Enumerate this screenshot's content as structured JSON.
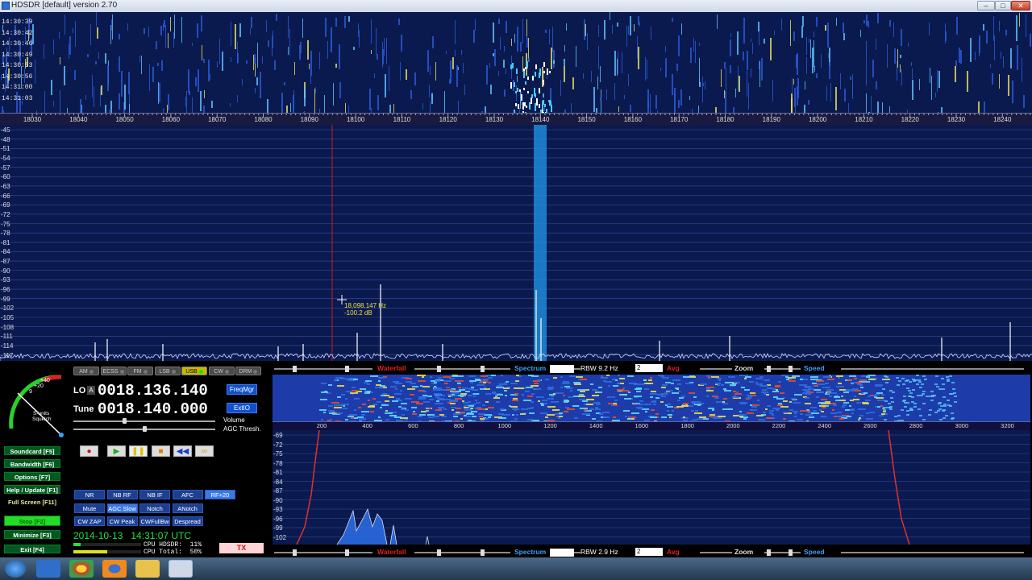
{
  "window": {
    "title": "HDSDR [default]  version 2.70",
    "minimize_glyph": "–",
    "maximize_glyph": "□",
    "close_glyph": "✕"
  },
  "waterfall": {
    "timestamps": [
      "14:30:39",
      "14:30:42",
      "14:30:46",
      "14:30:49",
      "14:30:53",
      "14:30:56",
      "14:31:00",
      "14:31:03"
    ]
  },
  "freq_scale": {
    "labels": [
      "18030",
      "18040",
      "18050",
      "18060",
      "18070",
      "18080",
      "18090",
      "18100",
      "18110",
      "18120",
      "18130",
      "18140",
      "18150",
      "18160",
      "18170",
      "18180",
      "18190",
      "18200",
      "18210",
      "18220",
      "18230",
      "18240"
    ]
  },
  "spectrum": {
    "db_labels": [
      "-45",
      "-48",
      "-51",
      "-54",
      "-57",
      "-60",
      "-63",
      "-66",
      "-69",
      "-72",
      "-75",
      "-78",
      "-81",
      "-84",
      "-87",
      "-90",
      "-93",
      "-96",
      "-99",
      "-102",
      "-105",
      "-108",
      "-111",
      "-114",
      "-117"
    ],
    "cursor_freq": "18,098.147 Hz",
    "cursor_level": "-100.2 dB"
  },
  "modes": {
    "buttons": [
      "AM",
      "ECSS",
      "FM",
      "LSB",
      "USB",
      "CW",
      "DRM"
    ],
    "active": "USB"
  },
  "smeter": {
    "label1": "S-units",
    "label2": "Squelch",
    "mark_plus20": "+20",
    "mark_plus40": "+40",
    "mark_9": "9"
  },
  "frequency": {
    "lo_label": "LO",
    "lo_badge": "A",
    "lo_value": "0018.136.140",
    "tune_label": "Tune",
    "tune_value": "0018.140.000",
    "freqmgr_label": "FreqMgr",
    "extio_label": "ExtIO",
    "volume_label": "Volume",
    "agc_label": "AGC Thresh."
  },
  "function_buttons": [
    "Soundcard  [F5]",
    "Bandwidth  [F6]",
    "Options  [F7]",
    "Help / Update  [F1]",
    "Full Screen  [F11]",
    "Stop  [F2]",
    "Minimize  [F3]",
    "Exit  [F4]"
  ],
  "dsp_buttons": [
    [
      "NR",
      "NB RF",
      "NB IF",
      "AFC",
      "RF+20"
    ],
    [
      "Mute",
      "AGC Slow",
      "Notch",
      "ANotch"
    ],
    [
      "CW ZAP",
      "CW Peak",
      "CWFullBw",
      "Despread"
    ]
  ],
  "status": {
    "datetime": "2014-10-13   14:31:07 UTC",
    "cpu_hdsdr": "CPU HDSDR:  11%",
    "cpu_total": "CPU Total:  50%",
    "tx_label": "TX"
  },
  "audio_controls": {
    "waterfall_label": "Waterfall",
    "spectrum_label": "Spectrum",
    "rbw_top": "RBW  9.2 Hz",
    "rbw_bottom": "RBW  2.9 Hz",
    "avg_value": "2",
    "avg_label": "Avg",
    "zoom_label": "Zoom",
    "speed_label": "Speed"
  },
  "audio_scale": {
    "labels": [
      "200",
      "400",
      "600",
      "800",
      "1000",
      "1200",
      "1400",
      "1600",
      "1800",
      "2000",
      "2200",
      "2400",
      "2600",
      "2800",
      "3000",
      "3200"
    ]
  },
  "audio_db": {
    "labels": [
      "-69",
      "-72",
      "-75",
      "-78",
      "-81",
      "-84",
      "-87",
      "-90",
      "-93",
      "-96",
      "-99",
      "-102"
    ]
  },
  "colors": {
    "spectrum_bg": "#0a1a4f",
    "spectrum_line": "#ffffff",
    "passband": "#1f8ad8",
    "tune_line": "#d01818",
    "function_green": "#005a1e",
    "stop_green": "#22dd22",
    "dsp_blue": "#1d3f92"
  },
  "taskbar": {
    "icons": [
      "start-orb-icon",
      "ie-icon",
      "chrome-icon",
      "firefox-icon",
      "folder-icon",
      "media-icon",
      "hdsdr-icon"
    ]
  }
}
